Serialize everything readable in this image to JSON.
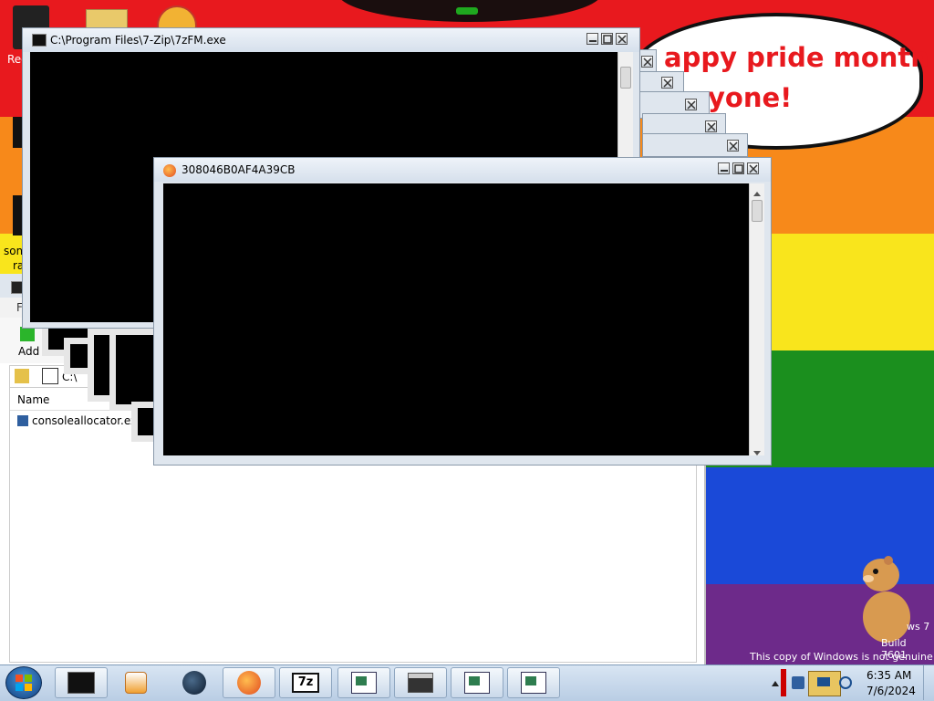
{
  "desktop": {
    "speech_line1": "appy pride month",
    "speech_line2": "yone!",
    "rainbow": [
      "#e8191e",
      "#f7891a",
      "#f9e51c",
      "#1b8f1e",
      "#1a49d8",
      "#6d2a8a"
    ],
    "watermark_line1": "ws 7",
    "watermark_line2": "Build 7601",
    "watermark_line3": "This copy of Windows is not genuine",
    "icon_label_1": "Rec",
    "icon_label_2": "som",
    "icon_label_3": "ra"
  },
  "window_7zip": {
    "title": "C:\\Program Files\\7-Zip\\7zFM.exe"
  },
  "window_firefox": {
    "title": "308046B0AF4A39CB"
  },
  "background_7zip": {
    "add_label": "Add",
    "menu_letter": "F",
    "path_prefix": "C:\\",
    "column_name": "Name",
    "file_name": "consoleallocator.exe"
  },
  "taskbar": {
    "time": "6:35 AM",
    "date": "7/6/2024",
    "items": [
      {
        "name": "Terminal"
      },
      {
        "name": "Windows Media Player"
      },
      {
        "name": "Dark globe app"
      },
      {
        "name": "Firefox"
      },
      {
        "name": "7-Zip"
      },
      {
        "name": "Window 1"
      },
      {
        "name": "Window 2"
      },
      {
        "name": "Window 3"
      },
      {
        "name": "Window 4"
      }
    ],
    "seven_zip_label": "7z"
  },
  "colors": {
    "speech_text": "#e8191e",
    "title_bar": "#d6e0ec",
    "taskbar": "#c4d6ea"
  }
}
